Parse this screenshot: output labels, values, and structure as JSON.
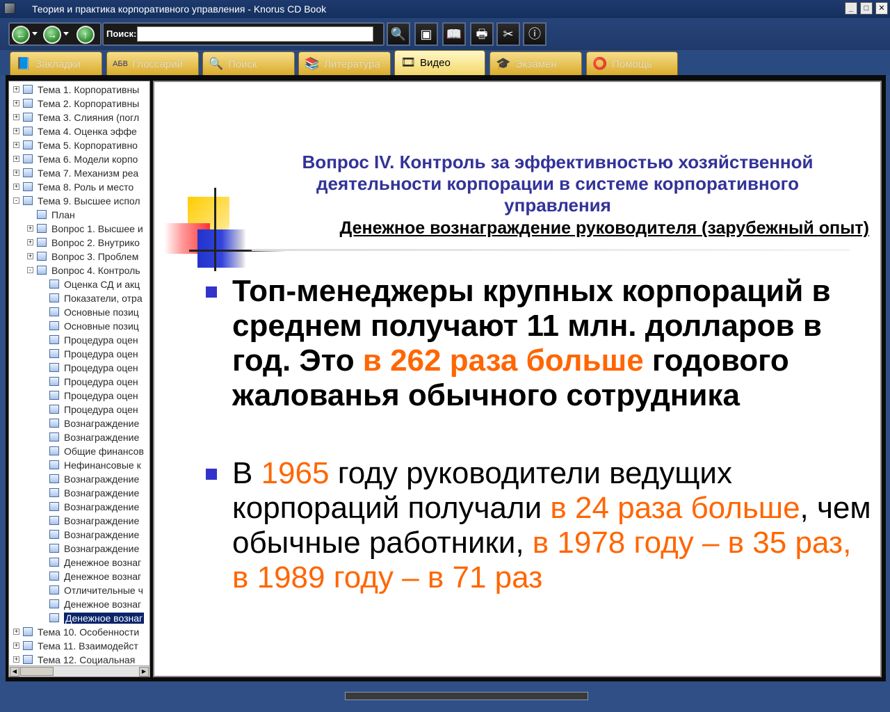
{
  "window": {
    "title": "Теория и практика корпоративного управления - Knorus CD Book",
    "minimize": "_",
    "maximize": "□",
    "close": "✕"
  },
  "toolbar": {
    "search_label": "Поиск:",
    "search_value": "",
    "back_icon": "back-arrow-icon",
    "forward_icon": "forward-arrow-icon",
    "up_icon": "up-arrow-icon",
    "tools": [
      "magnifier-icon",
      "frame-icon",
      "bookmark-book-icon",
      "print-icon",
      "tools-icon",
      "info-icon"
    ]
  },
  "tabs": [
    {
      "label": "Закладки",
      "icon": "book-icon",
      "active": false
    },
    {
      "label": "Глоссарий",
      "icon": "abc-icon",
      "active": false
    },
    {
      "label": "Поиск",
      "icon": "magnifier-icon",
      "active": false
    },
    {
      "label": "Литература",
      "icon": "books-icon",
      "active": false
    },
    {
      "label": "Видео",
      "icon": "film-icon",
      "active": true
    },
    {
      "label": "Экзамен",
      "icon": "graduation-cap-icon",
      "active": false
    },
    {
      "label": "Помощь",
      "icon": "lifebuoy-icon",
      "active": false
    }
  ],
  "tree": [
    {
      "label": "Тема 1. Корпоративны",
      "level": 0,
      "expander": "+"
    },
    {
      "label": "Тема 2. Корпоративны",
      "level": 0,
      "expander": "+"
    },
    {
      "label": "Тема 3. Слияния (погл",
      "level": 0,
      "expander": "+"
    },
    {
      "label": "Тема 4. Оценка эффе",
      "level": 0,
      "expander": "+"
    },
    {
      "label": "Тема 5. Корпоративно",
      "level": 0,
      "expander": "+"
    },
    {
      "label": "Тема 6. Модели корпо",
      "level": 0,
      "expander": "+"
    },
    {
      "label": "Тема 7. Механизм реа",
      "level": 0,
      "expander": "+"
    },
    {
      "label": "Тема 8. Роль и место",
      "level": 0,
      "expander": "+"
    },
    {
      "label": "Тема 9. Высшее испол",
      "level": 0,
      "expander": "-"
    },
    {
      "label": "План",
      "level": 1,
      "expander": ""
    },
    {
      "label": "Вопрос 1. Высшее и",
      "level": 1,
      "expander": "+"
    },
    {
      "label": "Вопрос 2. Внутрико",
      "level": 1,
      "expander": "+"
    },
    {
      "label": "Вопрос 3. Проблем",
      "level": 1,
      "expander": "+"
    },
    {
      "label": "Вопрос 4. Контроль",
      "level": 1,
      "expander": "-"
    },
    {
      "label": "Оценка СД и акц",
      "level": 2,
      "expander": ""
    },
    {
      "label": "Показатели, отра",
      "level": 2,
      "expander": ""
    },
    {
      "label": "Основные позиц",
      "level": 2,
      "expander": ""
    },
    {
      "label": "Основные позиц",
      "level": 2,
      "expander": ""
    },
    {
      "label": "Процедура оцен",
      "level": 2,
      "expander": ""
    },
    {
      "label": "Процедура оцен",
      "level": 2,
      "expander": ""
    },
    {
      "label": "Процедура оцен",
      "level": 2,
      "expander": ""
    },
    {
      "label": "Процедура оцен",
      "level": 2,
      "expander": ""
    },
    {
      "label": "Процедура оцен",
      "level": 2,
      "expander": ""
    },
    {
      "label": "Процедура оцен",
      "level": 2,
      "expander": ""
    },
    {
      "label": "Вознаграждение",
      "level": 2,
      "expander": ""
    },
    {
      "label": "Вознаграждение",
      "level": 2,
      "expander": ""
    },
    {
      "label": "Общие финансов",
      "level": 2,
      "expander": ""
    },
    {
      "label": "Нефинансовые к",
      "level": 2,
      "expander": ""
    },
    {
      "label": "Вознаграждение",
      "level": 2,
      "expander": ""
    },
    {
      "label": "Вознаграждение",
      "level": 2,
      "expander": ""
    },
    {
      "label": "Вознаграждение",
      "level": 2,
      "expander": ""
    },
    {
      "label": "Вознаграждение",
      "level": 2,
      "expander": ""
    },
    {
      "label": "Вознаграждение",
      "level": 2,
      "expander": ""
    },
    {
      "label": "Вознаграждение",
      "level": 2,
      "expander": ""
    },
    {
      "label": "Денежное вознаг",
      "level": 2,
      "expander": ""
    },
    {
      "label": "Денежное вознаг",
      "level": 2,
      "expander": ""
    },
    {
      "label": "Отличительные ч",
      "level": 2,
      "expander": ""
    },
    {
      "label": "Денежное вознаг",
      "level": 2,
      "expander": ""
    },
    {
      "label": "Денежное вознаг",
      "level": 2,
      "expander": "",
      "selected": true
    },
    {
      "label": "Тема 10. Особенности",
      "level": 0,
      "expander": "+"
    },
    {
      "label": "Тема 11. Взаимодейст",
      "level": 0,
      "expander": "+"
    },
    {
      "label": "Тема 12. Социальная",
      "level": 0,
      "expander": "+"
    }
  ],
  "slide": {
    "title": "Вопрос IV. Контроль за эффективностью хозяйственной деятельности корпорации в системе корпоративного управления",
    "subtitle": "Денежное вознаграждение руководителя (зарубежный опыт)",
    "bullet1": [
      {
        "text": "Топ-менеджеры крупных корпораций в среднем получают 11 млн. долларов в год. Это ",
        "hl": false
      },
      {
        "text": "в 262 раза больше",
        "hl": true
      },
      {
        "text": " годового жалованья обычного сотрудника",
        "hl": false
      }
    ],
    "bullet2": [
      {
        "text": "В ",
        "hl": false
      },
      {
        "text": "1965",
        "hl": true
      },
      {
        "text": " году руководители ведущих корпораций получали ",
        "hl": false
      },
      {
        "text": "в 24 раза больше",
        "hl": true
      },
      {
        "text": ", чем обычные работники, ",
        "hl": false
      },
      {
        "text": "в 1978 году – в 35 раз, в 1989 году – в 71 раз",
        "hl": true
      }
    ],
    "colors": {
      "title": "#333399",
      "highlight": "#ff6600",
      "bullet": "#3333cc"
    }
  }
}
